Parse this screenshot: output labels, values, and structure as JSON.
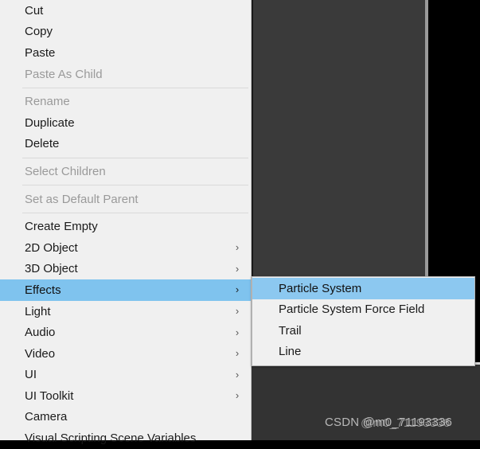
{
  "watermark": {
    "text": "CSDN @m0_71193336",
    "overlay_text": "@m0_71193336"
  },
  "context_menu": {
    "groups": [
      {
        "items": [
          {
            "label": "Cut",
            "disabled": false,
            "has_submenu": false,
            "highlighted": false
          },
          {
            "label": "Copy",
            "disabled": false,
            "has_submenu": false,
            "highlighted": false
          },
          {
            "label": "Paste",
            "disabled": false,
            "has_submenu": false,
            "highlighted": false
          },
          {
            "label": "Paste As Child",
            "disabled": true,
            "has_submenu": false,
            "highlighted": false
          }
        ]
      },
      {
        "items": [
          {
            "label": "Rename",
            "disabled": true,
            "has_submenu": false,
            "highlighted": false
          },
          {
            "label": "Duplicate",
            "disabled": false,
            "has_submenu": false,
            "highlighted": false
          },
          {
            "label": "Delete",
            "disabled": false,
            "has_submenu": false,
            "highlighted": false
          }
        ]
      },
      {
        "items": [
          {
            "label": "Select Children",
            "disabled": true,
            "has_submenu": false,
            "highlighted": false
          }
        ]
      },
      {
        "items": [
          {
            "label": "Set as Default Parent",
            "disabled": true,
            "has_submenu": false,
            "highlighted": false
          }
        ]
      },
      {
        "items": [
          {
            "label": "Create Empty",
            "disabled": false,
            "has_submenu": false,
            "highlighted": false
          },
          {
            "label": "2D Object",
            "disabled": false,
            "has_submenu": true,
            "highlighted": false
          },
          {
            "label": "3D Object",
            "disabled": false,
            "has_submenu": true,
            "highlighted": false
          },
          {
            "label": "Effects",
            "disabled": false,
            "has_submenu": true,
            "highlighted": true
          },
          {
            "label": "Light",
            "disabled": false,
            "has_submenu": true,
            "highlighted": false
          },
          {
            "label": "Audio",
            "disabled": false,
            "has_submenu": true,
            "highlighted": false
          },
          {
            "label": "Video",
            "disabled": false,
            "has_submenu": true,
            "highlighted": false
          },
          {
            "label": "UI",
            "disabled": false,
            "has_submenu": true,
            "highlighted": false
          },
          {
            "label": "UI Toolkit",
            "disabled": false,
            "has_submenu": true,
            "highlighted": false
          },
          {
            "label": "Camera",
            "disabled": false,
            "has_submenu": false,
            "highlighted": false
          },
          {
            "label": "Visual Scripting Scene Variables",
            "disabled": false,
            "has_submenu": false,
            "highlighted": false
          }
        ]
      }
    ],
    "submenu_arrow_glyph": "›"
  },
  "submenu": {
    "parent": "Effects",
    "items": [
      {
        "label": "Particle System",
        "highlighted": true
      },
      {
        "label": "Particle System Force Field",
        "highlighted": false
      },
      {
        "label": "Trail",
        "highlighted": false
      },
      {
        "label": "Line",
        "highlighted": false
      }
    ]
  },
  "colors": {
    "menu_background": "#f0f0f0",
    "highlight": "#7fc3ee",
    "submenu_highlight": "#8cc8f0",
    "text": "#1a1a1a",
    "disabled_text": "#9a9a9a",
    "separator": "#d9d9d9",
    "scene_panel": "#3a3a3a",
    "scene_black": "#000000"
  }
}
